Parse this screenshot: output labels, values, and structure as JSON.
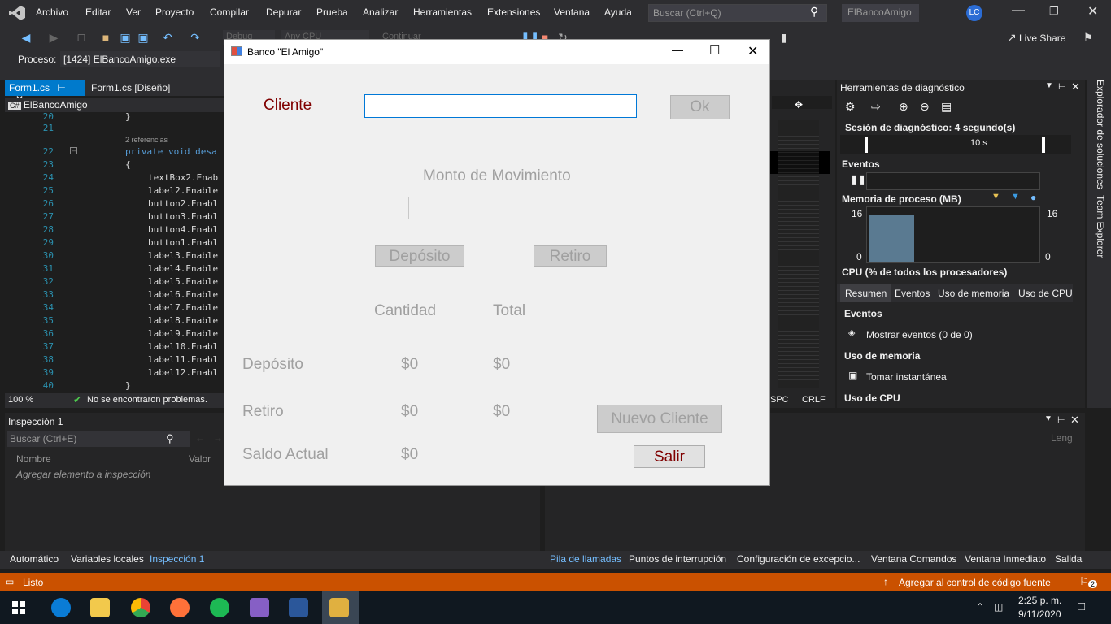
{
  "menubar": {
    "items": [
      "Archivo",
      "Editar",
      "Ver",
      "Proyecto",
      "Compilar",
      "Depurar",
      "Prueba",
      "Analizar",
      "Herramientas",
      "Extensiones",
      "Ventana",
      "Ayuda"
    ],
    "search_placeholder": "Buscar (Ctrl+Q)",
    "solution_name": "ElBancoAmigo",
    "user_initials": "LC"
  },
  "toolbar": {
    "config": "Debug",
    "platform": "Any CPU",
    "continue_label": "Continuar",
    "live_share": "Live Share"
  },
  "process_bar": {
    "label": "Proceso:",
    "value": "[1424] ElBancoAmigo.exe"
  },
  "editor": {
    "tab_active": "Form1.cs",
    "tab_other": "Form1.cs [Diseño]",
    "nav_project": "ElBancoAmigo",
    "references": "2 referencias",
    "zoom": "100 %",
    "problems": "No se encontraron problemas.",
    "lines": [
      {
        "num": "20",
        "text": "}"
      },
      {
        "num": "21",
        "text": ""
      },
      {
        "num": "22",
        "text": "private void desa"
      },
      {
        "num": "23",
        "text": "{"
      },
      {
        "num": "24",
        "text": "textBox2.Enab"
      },
      {
        "num": "25",
        "text": "label2.Enable"
      },
      {
        "num": "26",
        "text": "button2.Enabl"
      },
      {
        "num": "27",
        "text": "button3.Enabl"
      },
      {
        "num": "28",
        "text": "button4.Enabl"
      },
      {
        "num": "29",
        "text": "button1.Enabl"
      },
      {
        "num": "30",
        "text": "label3.Enable"
      },
      {
        "num": "31",
        "text": "label4.Enable"
      },
      {
        "num": "32",
        "text": "label5.Enable"
      },
      {
        "num": "33",
        "text": "label6.Enable"
      },
      {
        "num": "34",
        "text": "label7.Enable"
      },
      {
        "num": "35",
        "text": "label8.Enable"
      },
      {
        "num": "36",
        "text": "label9.Enable"
      },
      {
        "num": "37",
        "text": "label10.Enabl"
      },
      {
        "num": "38",
        "text": "label11.Enabl"
      },
      {
        "num": "39",
        "text": "label12.Enabl"
      },
      {
        "num": "40",
        "text": "}"
      }
    ]
  },
  "inspect": {
    "title": "Inspección 1",
    "search_placeholder": "Buscar (Ctrl+E)",
    "col_name": "Nombre",
    "col_value": "Valor",
    "add_item": "Agregar elemento a inspección",
    "right_col": "Leng"
  },
  "bottom_tabs": {
    "left": [
      "Automático",
      "Variables locales",
      "Inspección 1"
    ],
    "right": [
      "Pila de llamadas",
      "Puntos de interrupción",
      "Configuración de excepcio...",
      "Ventana Comandos",
      "Ventana Inmediato",
      "Salida"
    ]
  },
  "status": {
    "ready": "Listo",
    "source_control": "Agregar al control de código fuente",
    "notif_count": "2"
  },
  "mid_panel": {
    "spc": "SPC",
    "crlf": "CRLF"
  },
  "diagnostics": {
    "title": "Herramientas de diagnóstico",
    "session": "Sesión de diagnóstico: 4 segundo(s)",
    "timeline_label": "10 s",
    "events_hdr": "Eventos",
    "memory_hdr": "Memoria de proceso (MB)",
    "mem_max": "16",
    "mem_min": "0",
    "mem_fill": 0.85,
    "cpu_hdr": "CPU (% de todos los procesadores)",
    "tabs": [
      "Resumen",
      "Eventos",
      "Uso de memoria",
      "Uso de CPU"
    ],
    "sec_events": "Eventos",
    "show_events": "Mostrar eventos (0 de 0)",
    "sec_memory": "Uso de memoria",
    "snapshot": "Tomar instantánea",
    "sec_cpu": "Uso de CPU"
  },
  "side_tabs": {
    "solutions": "Explorador de soluciones",
    "team": "Team Explorer"
  },
  "dialog": {
    "title": "Banco \"El Amigo\"",
    "cliente_label": "Cliente",
    "ok_button": "Ok",
    "monto_label": "Monto de Movimiento",
    "deposito_button": "Depósito",
    "retiro_button": "Retiro",
    "cantidad_hdr": "Cantidad",
    "total_hdr": "Total",
    "row_deposito": "Depósito",
    "row_retiro": "Retiro",
    "row_saldo": "Saldo Actual",
    "dep_cantidad": "$0",
    "dep_total": "$0",
    "ret_cantidad": "$0",
    "ret_total": "$0",
    "saldo_cantidad": "$0",
    "nuevo_cliente_button": "Nuevo Cliente",
    "salir_button": "Salir"
  },
  "taskbar": {
    "time": "2:25 p. m.",
    "date": "9/11/2020"
  },
  "colors": {
    "vs_blue": "#007acc",
    "status_orange": "#ca5100",
    "form_label_red": "#800000"
  }
}
